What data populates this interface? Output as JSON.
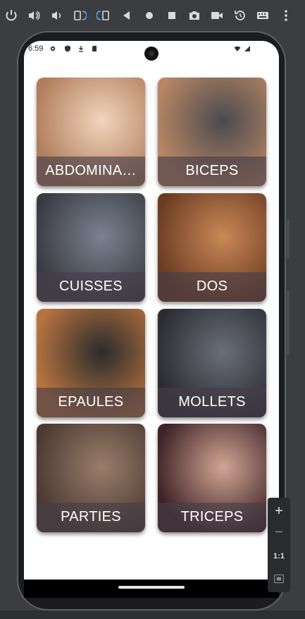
{
  "emulator_toolbar": {
    "icons": [
      "power-icon",
      "volume-up-icon",
      "volume-down-icon",
      "rotate-left-icon",
      "rotate-right-icon",
      "back-icon",
      "home-icon",
      "overview-icon",
      "camera-icon",
      "video-icon",
      "history-icon",
      "keyboard-icon",
      "more-icon"
    ]
  },
  "status_bar": {
    "time": "6:59",
    "left_icons": [
      "settings-icon",
      "shield-icon",
      "download-icon",
      "sd-card-icon"
    ],
    "right_icons": [
      "wifi-icon",
      "signal-icon"
    ]
  },
  "categories": [
    {
      "label": "ABDOMINA…",
      "image": "abdominals-photo",
      "tone": [
        "#f2d4bd",
        "#b07e5c"
      ]
    },
    {
      "label": "BICEPS",
      "image": "biceps-photo",
      "tone": [
        "#4a4a4f",
        "#b88663"
      ]
    },
    {
      "label": "CUISSES",
      "image": "thighs-photo",
      "tone": [
        "#7a8190",
        "#3a3b42"
      ]
    },
    {
      "label": "DOS",
      "image": "back-photo",
      "tone": [
        "#c98858",
        "#6b3c22"
      ]
    },
    {
      "label": "EPAULES",
      "image": "shoulders-photo",
      "tone": [
        "#2b2b2d",
        "#b8743e"
      ]
    },
    {
      "label": "MOLLETS",
      "image": "calves-photo",
      "tone": [
        "#6a6e78",
        "#2c2d33"
      ]
    },
    {
      "label": "PARTIES",
      "image": "chest-photo",
      "tone": [
        "#9a7d6a",
        "#4b3a33"
      ]
    },
    {
      "label": "TRICEPS",
      "image": "triceps-photo",
      "tone": [
        "#d2a595",
        "#3d2227"
      ]
    }
  ],
  "zoom_panel": {
    "zoom_in": "+",
    "zoom_out": "−",
    "actual_size": "1:1"
  },
  "colors": {
    "label_overlay": "#463e48",
    "toolbar_bg": "#3b3d40"
  }
}
